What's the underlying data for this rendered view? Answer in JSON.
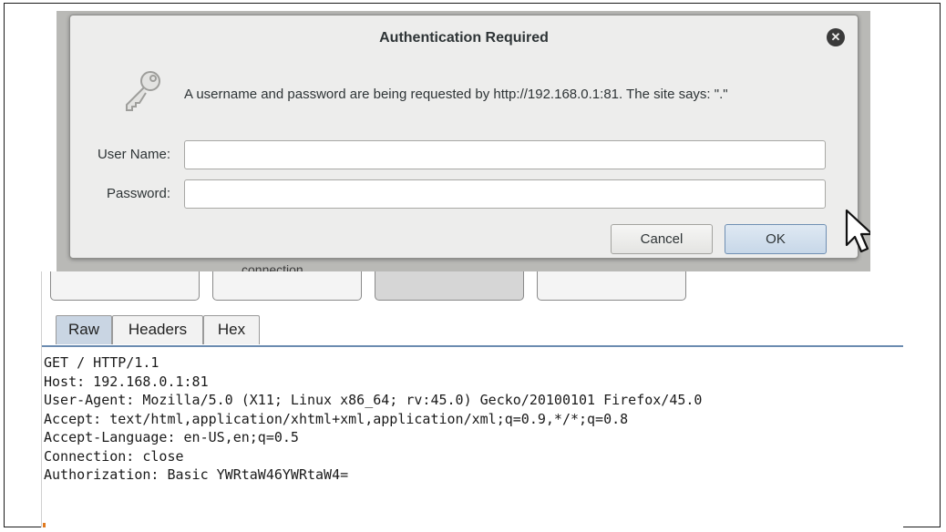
{
  "dialog": {
    "title": "Authentication Required",
    "message": "A username and password are being requested by http://192.168.0.1:81. The site says: \".\"",
    "username_label": "User Name:",
    "username_value": "",
    "password_label": "Password:",
    "password_value": "",
    "cancel_label": "Cancel",
    "ok_label": "OK",
    "close_icon": "close-icon",
    "key_icon": "key-icon"
  },
  "background_text": "connection.",
  "burp": {
    "tabs": [
      {
        "label": "Raw",
        "active": true
      },
      {
        "label": "Headers",
        "active": false
      },
      {
        "label": "Hex",
        "active": false
      }
    ],
    "request_lines": [
      "GET / HTTP/1.1",
      "Host: 192.168.0.1:81",
      "User-Agent: Mozilla/5.0 (X11; Linux x86_64; rv:45.0) Gecko/20100101 Firefox/45.0",
      "Accept: text/html,application/xhtml+xml,application/xml;q=0.9,*/*;q=0.8",
      "Accept-Language: en-US,en;q=0.5",
      "Connection: close",
      "Authorization: Basic YWRtaW46YWRtaW4="
    ]
  },
  "colors": {
    "dialog_bg": "#ededec",
    "ok_button": "#c7d7e8",
    "active_tab": "#c9d5e3",
    "tab_underline": "#6b8bb0"
  }
}
